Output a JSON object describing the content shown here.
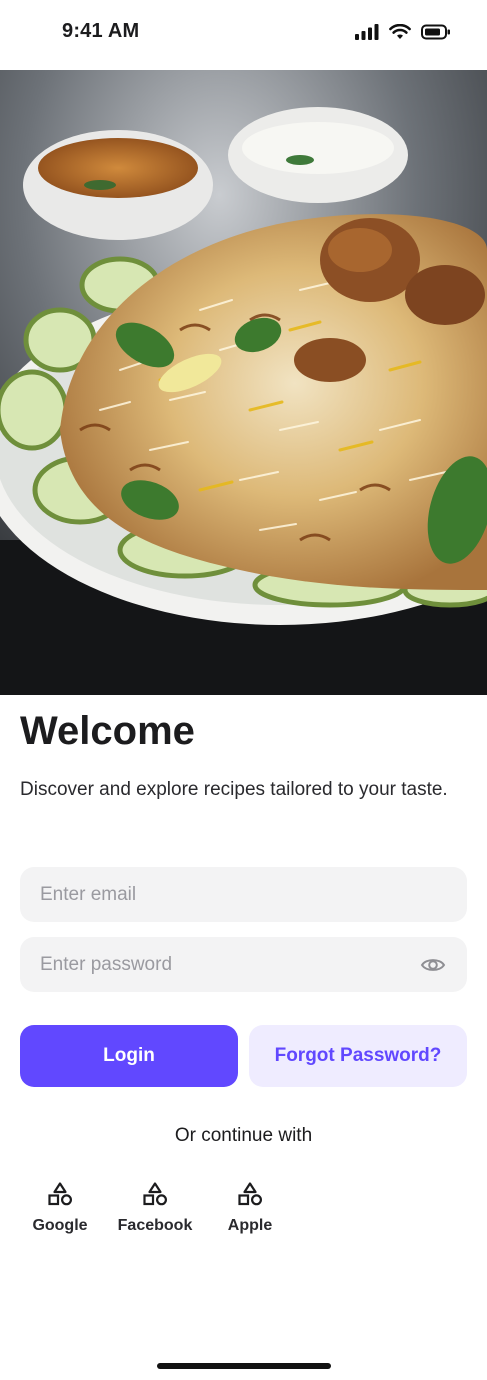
{
  "status_bar": {
    "time": "9:41 AM",
    "icons": [
      "cellular-signal-icon",
      "wifi-icon",
      "battery-icon"
    ]
  },
  "hero": {
    "image": "biryani-plate-photo"
  },
  "welcome": {
    "title": "Welcome",
    "subtitle": "Discover and explore recipes tailored to your taste."
  },
  "form": {
    "email_placeholder": "Enter email",
    "email_value": "",
    "password_placeholder": "Enter password",
    "password_value": "",
    "password_toggle_icon": "eye-icon"
  },
  "actions": {
    "login_label": "Login",
    "forgot_label": "Forgot Password?"
  },
  "social": {
    "heading": "Or continue with",
    "providers": [
      {
        "label": "Google",
        "icon": "shapes-icon"
      },
      {
        "label": "Facebook",
        "icon": "shapes-icon"
      },
      {
        "label": "Apple",
        "icon": "shapes-icon"
      }
    ]
  },
  "colors": {
    "accent": "#6148ff",
    "accent_soft": "#efecff",
    "field_bg": "#f3f3f4",
    "text": "#1c1c1e"
  }
}
